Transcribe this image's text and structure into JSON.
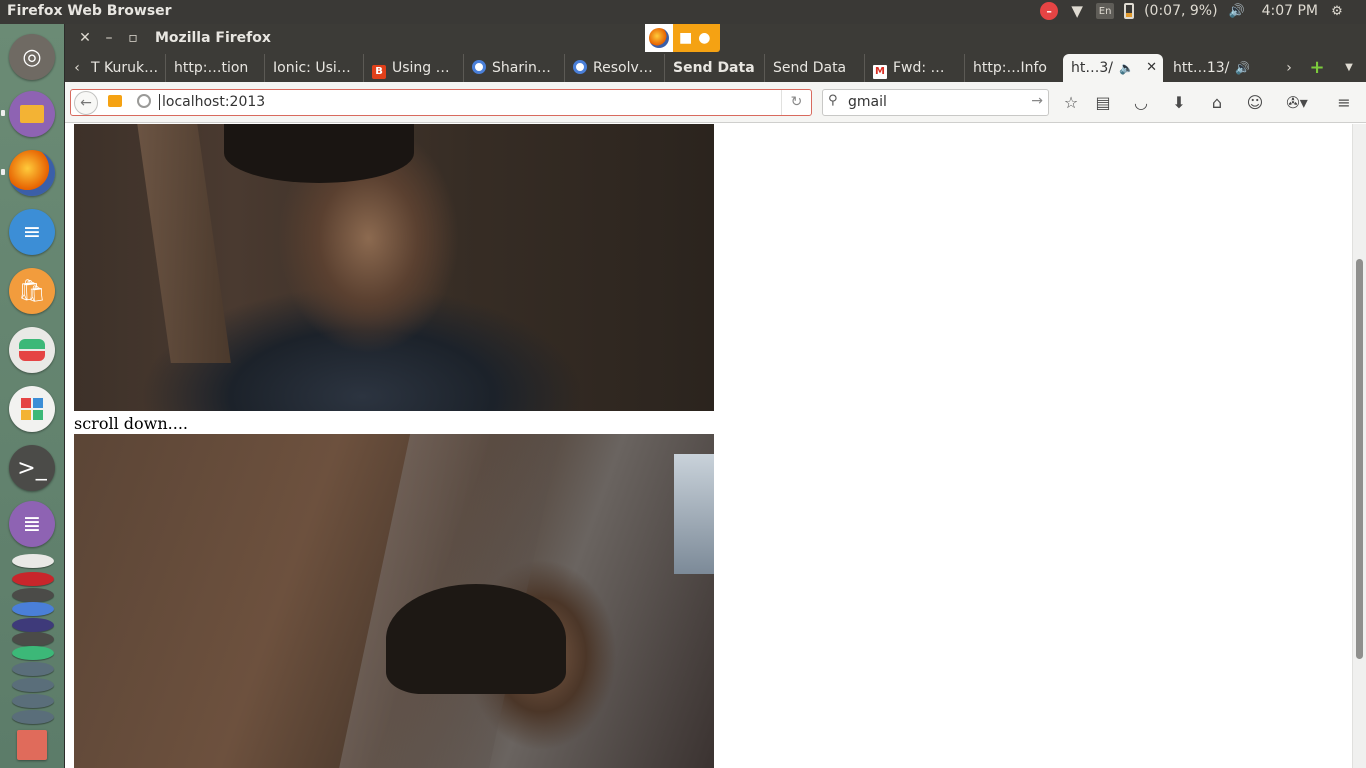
{
  "top_panel": {
    "title": "Firefox Web Browser",
    "battery_text": "(0:07, 9%)",
    "clock": "4:07 PM"
  },
  "launcher": {
    "items": [
      "ubuntu-dash",
      "files",
      "firefox",
      "libreoffice-writer",
      "ubuntu-software",
      "system-settings",
      "apps",
      "terminal",
      "text-editor"
    ]
  },
  "window": {
    "title": "Mozilla Firefox"
  },
  "tabs": [
    {
      "label": "T Kuruk…"
    },
    {
      "label": "http:…tion"
    },
    {
      "label": "Ionic: Usi…"
    },
    {
      "label": "Using …"
    },
    {
      "label": "Sharin…"
    },
    {
      "label": "Resolv…"
    },
    {
      "label": "Send Data"
    },
    {
      "label": "Send Data"
    },
    {
      "label": "Fwd: …"
    },
    {
      "label": "http:…Info"
    },
    {
      "label": "ht…3/"
    },
    {
      "label": "htt…13/"
    }
  ],
  "navbar": {
    "url": "localhost:2013",
    "search_value": "gmail"
  },
  "page": {
    "scroll_text": "scroll down...."
  },
  "colors": {
    "sharing_indicator": "#f5a213",
    "panel": "#3c3b37"
  }
}
